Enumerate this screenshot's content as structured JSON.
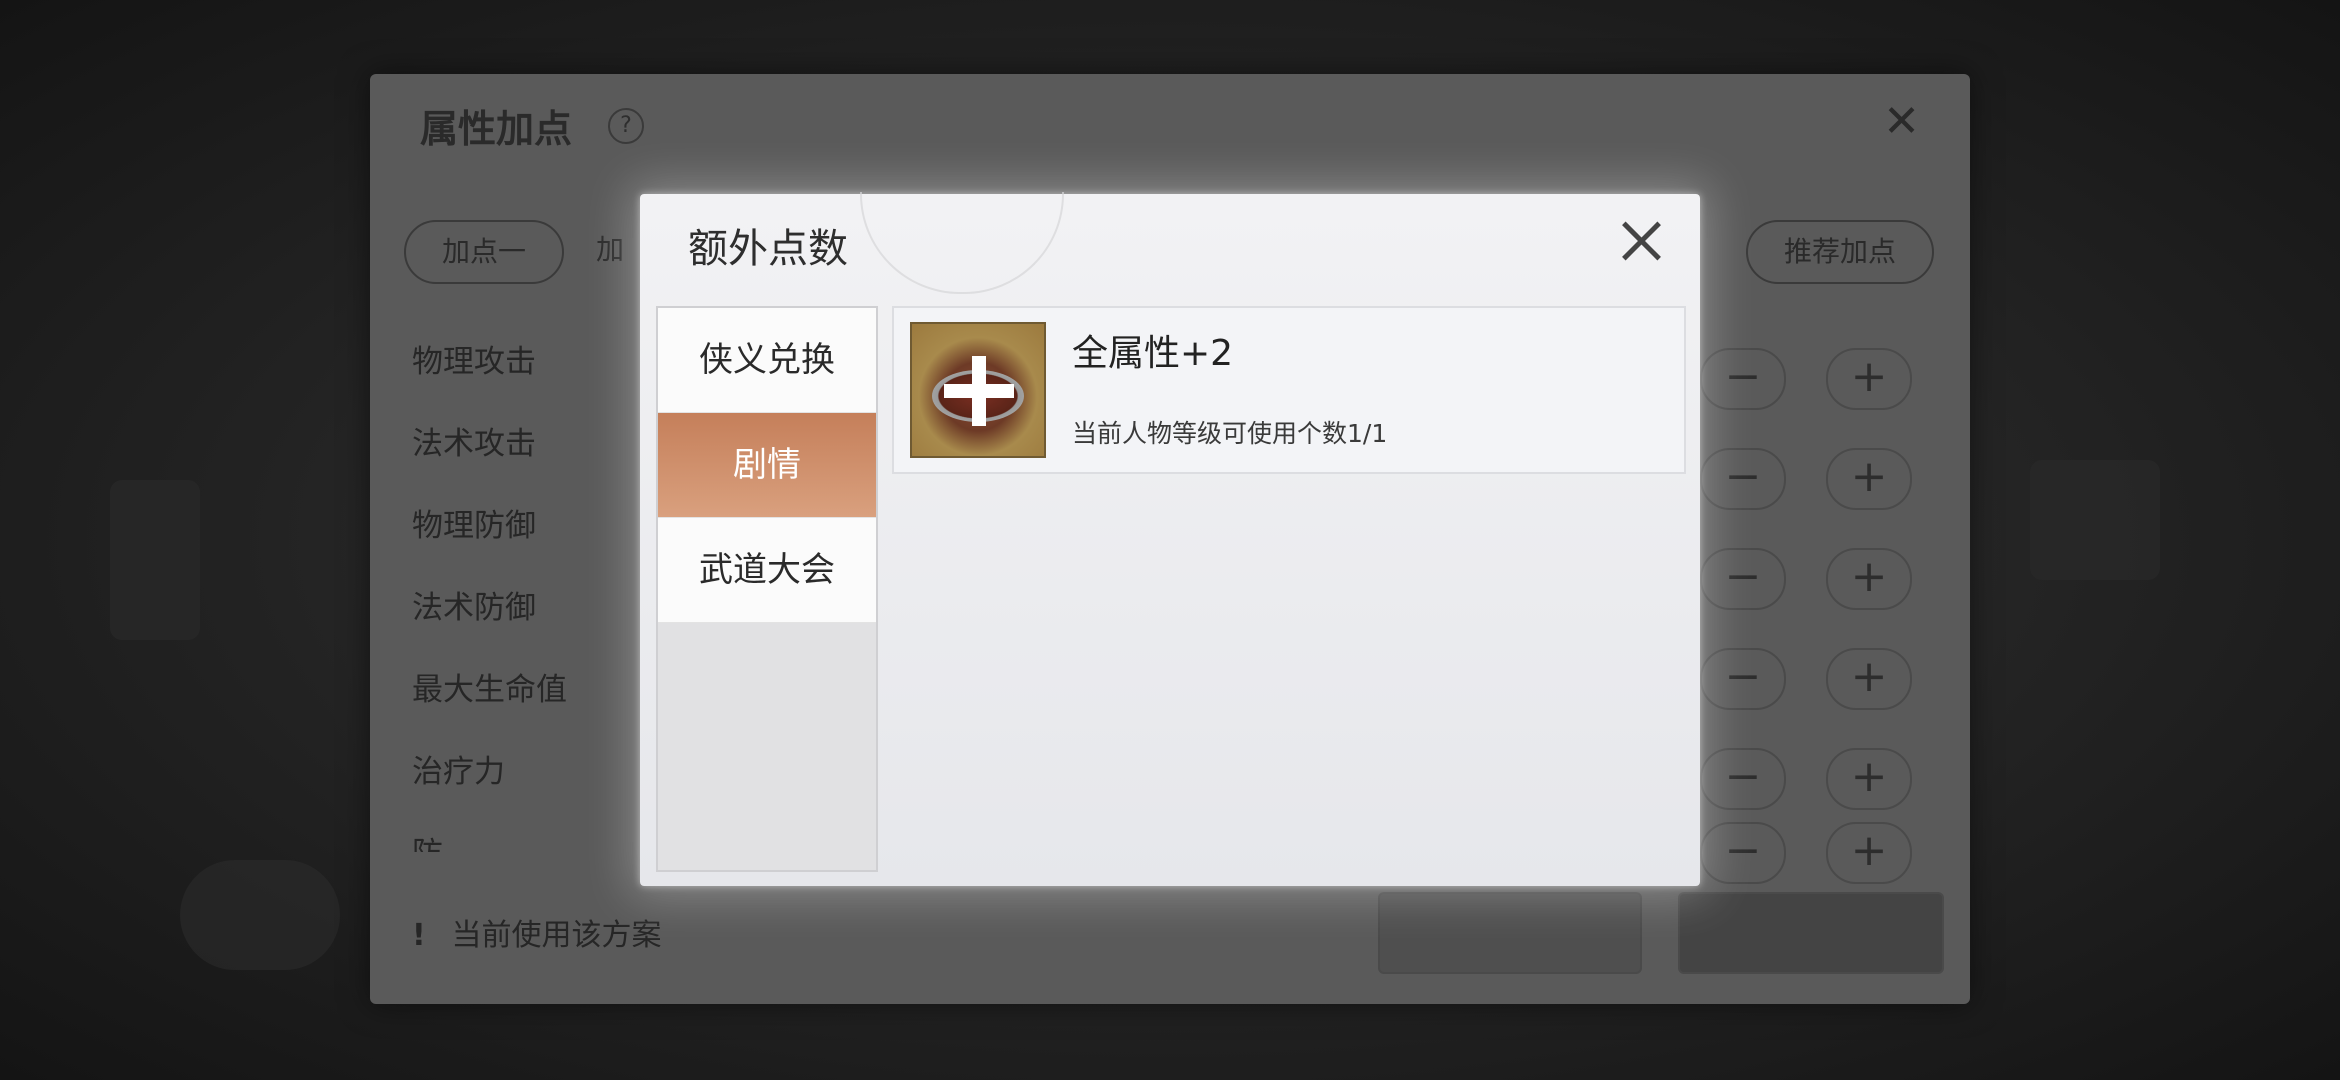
{
  "background_panel": {
    "title": "属性加点",
    "help_icon": "question-circle-icon",
    "close_icon": "close-icon",
    "plan_tabs": [
      "加点一",
      "加"
    ],
    "recommend_label": "推荐加点",
    "stats": [
      "物理攻击",
      "法术攻击",
      "物理防御",
      "法术防御",
      "最大生命值",
      "治疗力",
      "防..."
    ],
    "minus_glyph": "−",
    "plus_glyph": "+",
    "footer_note": "当前使用该方案",
    "footer_icon": "!"
  },
  "modal": {
    "title": "额外点数",
    "close_icon": "close-x-icon",
    "tabs": [
      {
        "label": "侠义兑换",
        "active": false
      },
      {
        "label": "剧情",
        "active": true
      },
      {
        "label": "武道大会",
        "active": false
      }
    ],
    "items": [
      {
        "name": "全属性+2",
        "description": "当前人物等级可使用个数1/1",
        "icon": "stat-plus-food-icon"
      }
    ]
  },
  "colors": {
    "active_tab": "#c9855f",
    "modal_bg": "#eeeeF0",
    "overlay": "#161616"
  }
}
